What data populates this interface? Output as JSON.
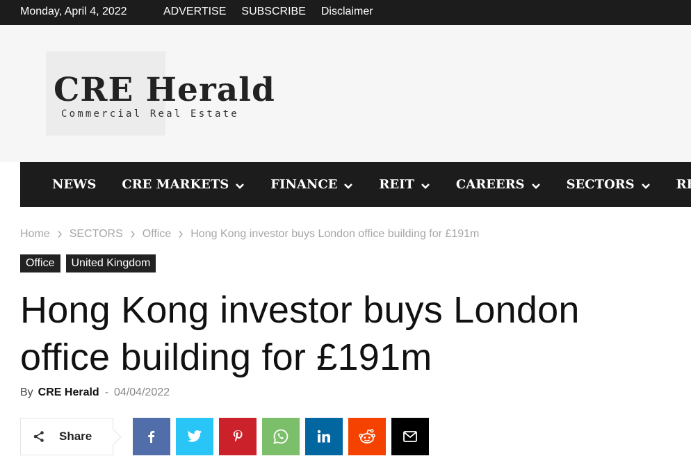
{
  "topbar": {
    "date": "Monday, April 4, 2022",
    "links": [
      "ADVERTISE",
      "SUBSCRIBE",
      "Disclaimer"
    ]
  },
  "logo": {
    "main": "CRE Herald",
    "sub": "Commercial Real Estate"
  },
  "nav": {
    "items": [
      {
        "label": "NEWS",
        "has_dropdown": false
      },
      {
        "label": "CRE MARKETS",
        "has_dropdown": true
      },
      {
        "label": "FINANCE",
        "has_dropdown": true
      },
      {
        "label": "REIT",
        "has_dropdown": true
      },
      {
        "label": "CAREERS",
        "has_dropdown": true
      },
      {
        "label": "SECTORS",
        "has_dropdown": true
      },
      {
        "label": "RESEARCH",
        "has_dropdown": false
      }
    ]
  },
  "breadcrumb": {
    "items": [
      "Home",
      "SECTORS",
      "Office",
      "Hong Kong investor buys London office building for £191m"
    ]
  },
  "tags": [
    "Office",
    "United Kingdom"
  ],
  "article": {
    "title": "Hong Kong investor buys London office building for £191m",
    "by_label": "By",
    "author": "CRE Herald",
    "dash": "-",
    "date": "04/04/2022"
  },
  "share": {
    "label": "Share",
    "icon": "share-icon"
  },
  "social": [
    {
      "name": "facebook",
      "icon": "facebook-icon",
      "color": "#516eab"
    },
    {
      "name": "twitter",
      "icon": "twitter-icon",
      "color": "#29c5f6"
    },
    {
      "name": "pinterest",
      "icon": "pinterest-icon",
      "color": "#ca212a"
    },
    {
      "name": "whatsapp",
      "icon": "whatsapp-icon",
      "color": "#7bbf6a"
    },
    {
      "name": "linkedin",
      "icon": "linkedin-icon",
      "color": "#0266a0"
    },
    {
      "name": "reddit",
      "icon": "reddit-icon",
      "color": "#f54200"
    },
    {
      "name": "email",
      "icon": "envelope-icon",
      "color": "#000000"
    }
  ],
  "colors": {
    "topbar_bg": "#1c1c1c",
    "nav_bg": "#1c1c1c",
    "header_bg": "#f6f6f6",
    "tag_bg": "#222222"
  }
}
